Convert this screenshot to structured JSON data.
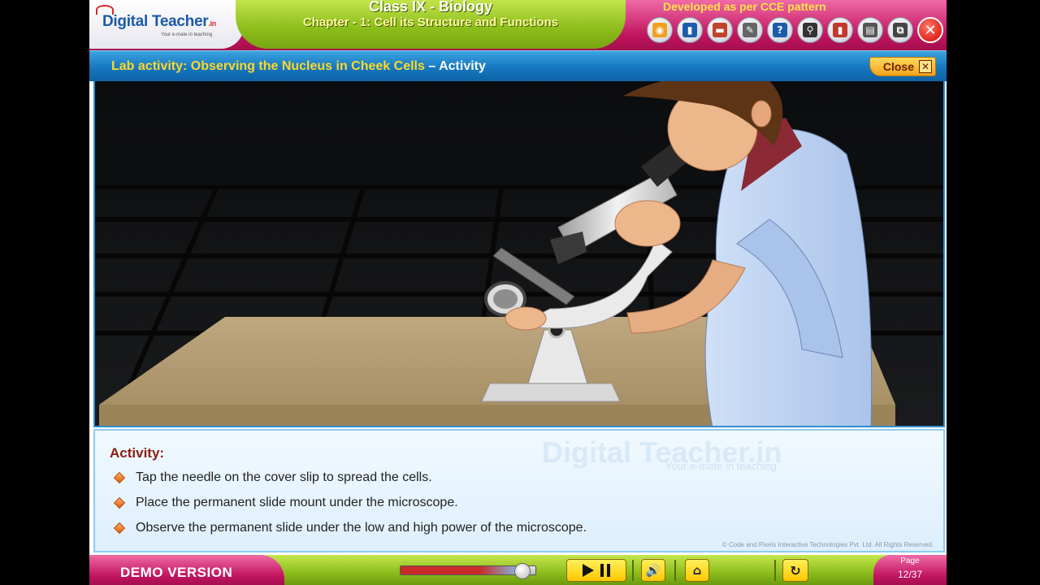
{
  "header": {
    "logo_text_1": "Digital",
    "logo_text_2": "Teacher",
    "logo_suffix": ".in",
    "logo_tagline": "Your e-mate in teaching",
    "title": "Class IX - Biology",
    "subtitle": "Chapter - 1: Cell its Structure and Functions",
    "cce": "Developed as per CCE pattern",
    "toolbar": [
      {
        "name": "media-icon",
        "glyph": "◉",
        "color": "#f0a020"
      },
      {
        "name": "book-icon",
        "glyph": "▮",
        "color": "#1e5cab"
      },
      {
        "name": "notebook-icon",
        "glyph": "▬",
        "color": "#c0442a"
      },
      {
        "name": "notepad-icon",
        "glyph": "✎",
        "color": "#666"
      },
      {
        "name": "help-icon",
        "glyph": "?",
        "color": "#1e5cab"
      },
      {
        "name": "search-icon",
        "glyph": "⚲",
        "color": "#333"
      },
      {
        "name": "dictionary-icon",
        "glyph": "▮",
        "color": "#c0392b"
      },
      {
        "name": "print-icon",
        "glyph": "▤",
        "color": "#555"
      },
      {
        "name": "window-icon",
        "glyph": "⧉",
        "color": "#444"
      }
    ],
    "exit_glyph": "✕"
  },
  "activity_bar": {
    "title": "Lab activity: Observing the Nucleus in Cheek Cells",
    "dash": " – ",
    "suffix": "Activity",
    "close_label": "Close",
    "close_glyph": "✕"
  },
  "panel": {
    "title": "Activity:",
    "steps": [
      "Tap the needle on the cover slip to spread the cells.",
      "Place the permanent slide mount under the microscope.",
      "Observe the permanent slide under the low and high power of the microscope."
    ],
    "watermark": "Digital Teacher.in",
    "watermark_tagline": "Your e-mate in teaching",
    "copyright": "© Code and Pixels Interactive Technologies  Pvt. Ltd. All Rights Reserved."
  },
  "bottom": {
    "demo_label": "DEMO VERSION",
    "progress_fraction": 0.9,
    "volume_glyph": "🔊",
    "home_glyph": "⌂",
    "replay_glyph": "↻",
    "page_label": "Page",
    "page_value": "12/37"
  }
}
